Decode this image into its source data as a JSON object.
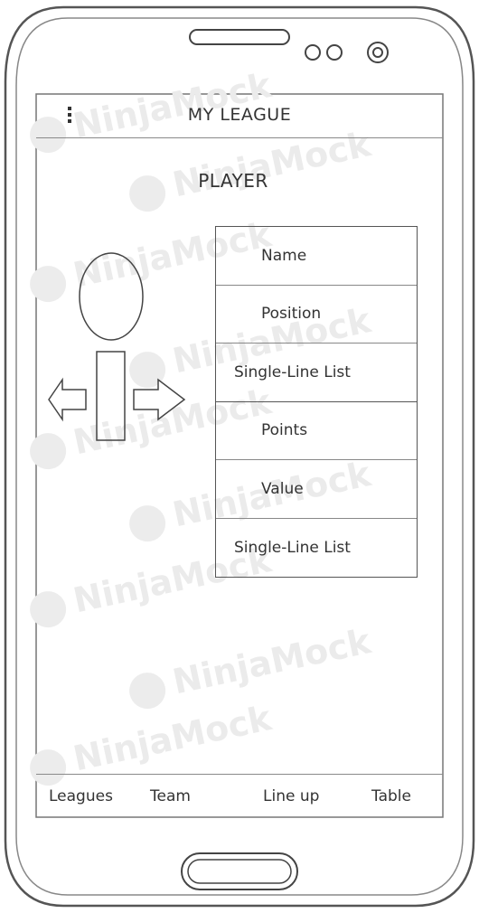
{
  "app": {
    "title": "MY LEAGUE",
    "menu_icon": "overflow-menu-icon"
  },
  "page": {
    "title": "PLAYER"
  },
  "player_details": [
    {
      "label": "Name"
    },
    {
      "label": "Position"
    },
    {
      "label": "Single-Line List"
    },
    {
      "label": "Points"
    },
    {
      "label": "Value"
    },
    {
      "label": "Single-Line List"
    }
  ],
  "bottom_nav": {
    "leagues": "Leagues",
    "team": "Team",
    "lineup": "Line up",
    "table": "Table"
  },
  "watermark": "NinjaMock"
}
